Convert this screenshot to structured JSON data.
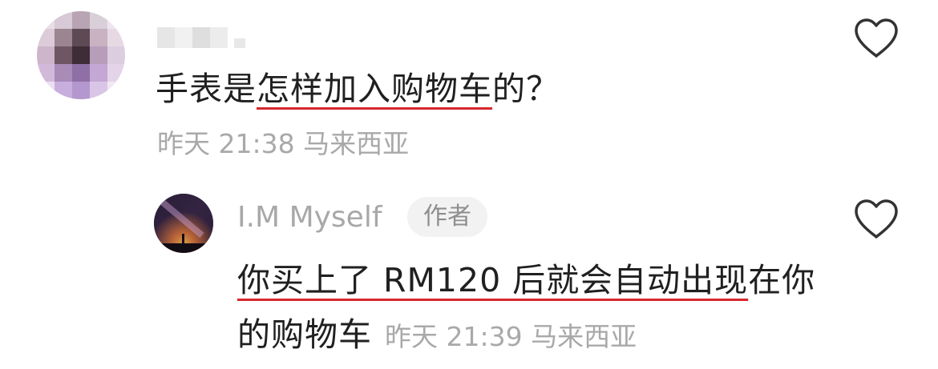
{
  "comment": {
    "text_before": "手表是",
    "text_highlight": "怎样加入购物车",
    "text_after": "的？",
    "time": "昨天 21:38",
    "location": "马来西亚"
  },
  "reply": {
    "author": "I.M Myself",
    "badge": "作者",
    "text_highlight": "你买上了 RM120 后就会自动出现",
    "text_after": "在你的购物车",
    "time": "昨天 21:39",
    "location": "马来西亚"
  },
  "icons": {
    "like": "heart-outline-icon"
  },
  "colors": {
    "highlight_underline": "#d6262c",
    "meta_text": "#a9a9a9"
  }
}
